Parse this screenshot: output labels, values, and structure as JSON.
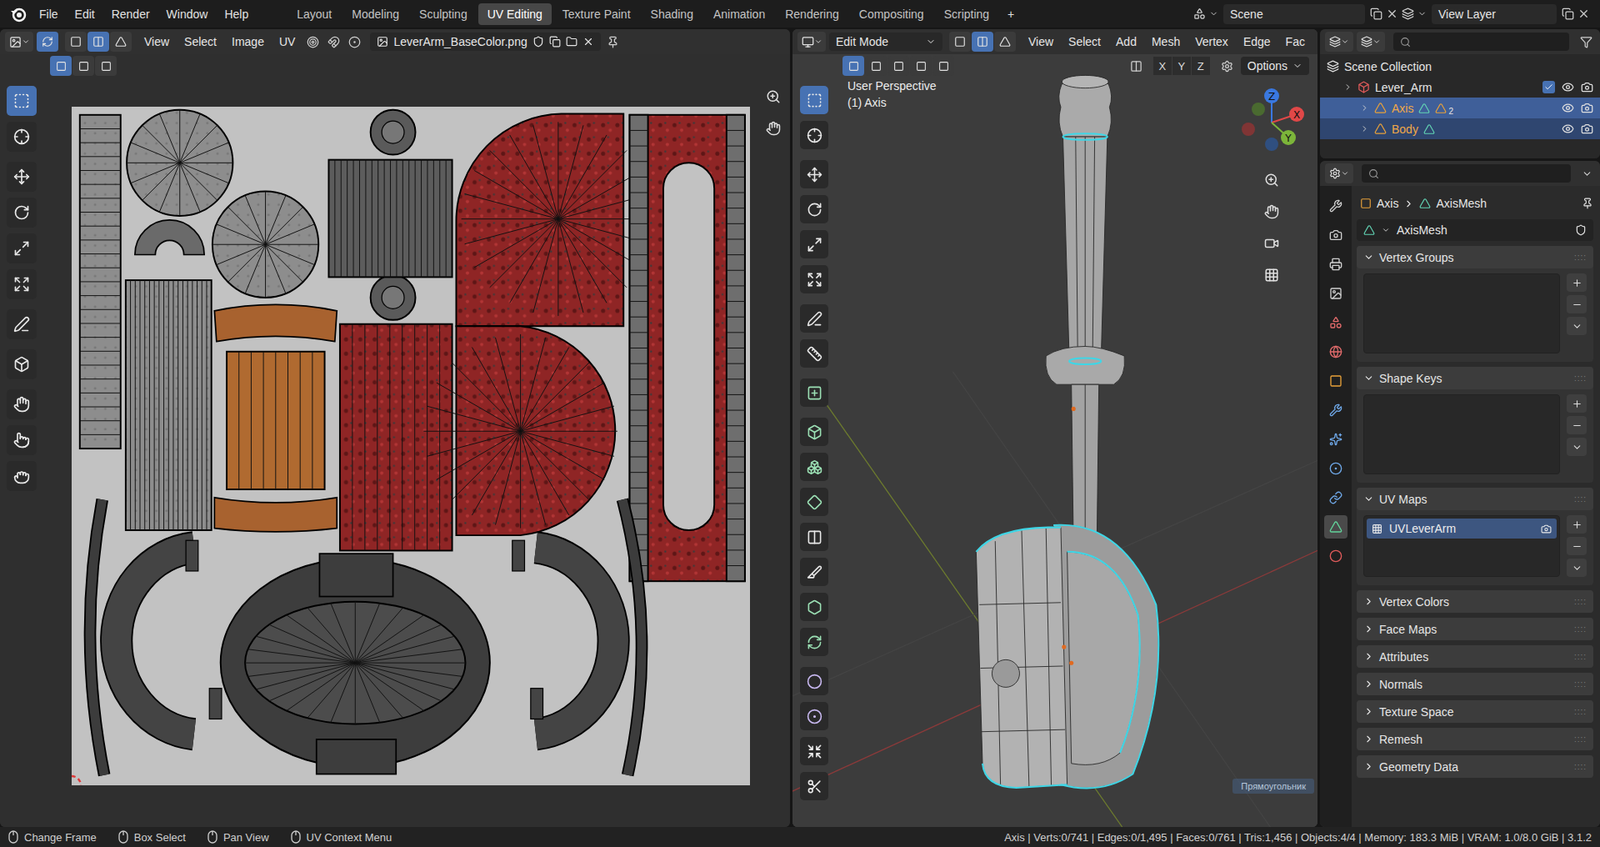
{
  "topbar": {
    "menus": [
      "File",
      "Edit",
      "Render",
      "Window",
      "Help"
    ],
    "workspaces": [
      {
        "label": "Layout",
        "selected": false
      },
      {
        "label": "Modeling",
        "selected": false
      },
      {
        "label": "Sculpting",
        "selected": false
      },
      {
        "label": "UV Editing",
        "selected": true
      },
      {
        "label": "Texture Paint",
        "selected": false
      },
      {
        "label": "Shading",
        "selected": false
      },
      {
        "label": "Animation",
        "selected": false
      },
      {
        "label": "Rendering",
        "selected": false
      },
      {
        "label": "Compositing",
        "selected": false
      },
      {
        "label": "Scripting",
        "selected": false
      }
    ],
    "add_workspace": "+",
    "scene": "Scene",
    "view_layer": "View Layer"
  },
  "uv_editor": {
    "menus": [
      "View",
      "Select",
      "Image",
      "UV"
    ],
    "image_name": "LeverArm_BaseColor.png",
    "sync_selection": true,
    "select_modes": [
      {
        "selected": false
      },
      {
        "selected": true
      },
      {
        "selected": false
      }
    ],
    "subrow_modes": [
      {
        "selected": true
      },
      {
        "selected": false
      },
      {
        "selected": false
      }
    ],
    "tools": [
      {
        "selected": true
      },
      {
        "selected": false
      },
      {
        "selected": false
      },
      {
        "selected": false
      },
      {
        "selected": false
      },
      {
        "selected": false
      },
      {
        "selected": false
      },
      {
        "selected": false
      },
      {
        "selected": false
      },
      {
        "selected": false
      },
      {
        "selected": false
      }
    ]
  },
  "viewport": {
    "mode": "Edit Mode",
    "select_modes": [
      {
        "selected": false
      },
      {
        "selected": true
      },
      {
        "selected": false
      }
    ],
    "menus": [
      "View",
      "Select",
      "Add",
      "Mesh",
      "Vertex",
      "Edge",
      "Fac"
    ],
    "subrow_modes": [
      {
        "selected": true
      },
      {
        "selected": false
      },
      {
        "selected": false
      },
      {
        "selected": false
      },
      {
        "selected": false
      }
    ],
    "axis_buttons": [
      "X",
      "Y",
      "Z"
    ],
    "options": "Options",
    "view_name": "User Perspective",
    "object_label": "(1) Axis",
    "gizmo": {
      "x": "X",
      "y": "Y",
      "z": "Z"
    },
    "tools": [
      {
        "selected": true
      },
      {
        "selected": false
      },
      {
        "selected": false
      },
      {
        "selected": false
      },
      {
        "selected": false
      },
      {
        "selected": false
      },
      {
        "selected": false
      },
      {
        "selected": false
      },
      {
        "selected": false
      },
      {
        "selected": false
      },
      {
        "selected": false
      },
      {
        "selected": false
      },
      {
        "selected": false
      },
      {
        "selected": false
      },
      {
        "selected": false
      },
      {
        "selected": false
      },
      {
        "selected": false
      },
      {
        "selected": false
      },
      {
        "selected": false
      },
      {
        "selected": false
      }
    ],
    "hint": "Прямоугольник"
  },
  "outliner": {
    "rows": [
      {
        "name": "Scene Collection",
        "depth": 0,
        "kind": "scene",
        "selected": false,
        "active": false
      },
      {
        "name": "Lever_Arm",
        "depth": 1,
        "kind": "collection",
        "selected": false,
        "active": false,
        "checked": true
      },
      {
        "name": "Axis",
        "depth": 2,
        "kind": "object",
        "selected": true,
        "active": true,
        "modifier_count": "2"
      },
      {
        "name": "Body",
        "depth": 2,
        "kind": "object",
        "selected": true,
        "active": false
      }
    ]
  },
  "properties": {
    "tabs": [
      {
        "selected": false
      },
      {
        "selected": false
      },
      {
        "selected": false
      },
      {
        "selected": false
      },
      {
        "selected": false
      },
      {
        "selected": false
      },
      {
        "selected": false
      },
      {
        "selected": false
      },
      {
        "selected": false
      },
      {
        "selected": false
      },
      {
        "selected": false
      },
      {
        "selected": true
      },
      {
        "selected": false
      }
    ],
    "breadcrumb": [
      "Axis",
      "AxisMesh"
    ],
    "data_name": "AxisMesh",
    "panels": [
      {
        "label": "Vertex Groups",
        "expanded": true,
        "items": []
      },
      {
        "label": "Shape Keys",
        "expanded": true,
        "items": []
      },
      {
        "label": "UV Maps",
        "expanded": true,
        "items": [
          {
            "name": "UVLeverArm",
            "selected": true
          }
        ]
      },
      {
        "label": "Vertex Colors",
        "expanded": false
      },
      {
        "label": "Face Maps",
        "expanded": false
      },
      {
        "label": "Attributes",
        "expanded": false
      },
      {
        "label": "Normals",
        "expanded": false
      },
      {
        "label": "Texture Space",
        "expanded": false
      },
      {
        "label": "Remesh",
        "expanded": false
      },
      {
        "label": "Geometry Data",
        "expanded": false
      }
    ]
  },
  "status_bar": {
    "hints": [
      "Change Frame",
      "Box Select",
      "Pan View",
      "UV Context Menu"
    ],
    "stats": "Axis | Verts:0/741 | Edges:0/1,495 | Faces:0/761 | Tris:1,456 | Objects:4/4 | Memory: 183.3 MiB | VRAM: 1.0/8.0 GiB | 3.1.2"
  }
}
